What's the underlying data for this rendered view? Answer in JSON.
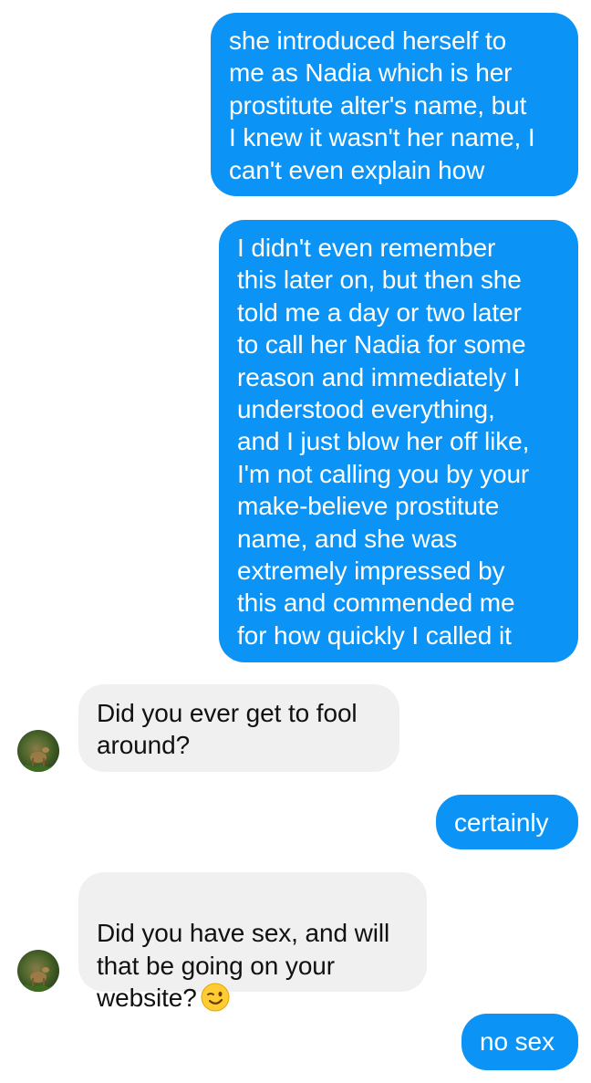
{
  "conversation": {
    "messages": [
      {
        "side": "outgoing",
        "text": "she introduced herself to\nme as Nadia which is her\nprostitute alter's name, but\nI knew it wasn't her name, I\ncan't even explain how"
      },
      {
        "side": "outgoing",
        "text": "I didn't even remember\nthis later on, but then she\ntold me a day or two later\nto call her Nadia for some\nreason and immediately I\nunderstood everything,\nand I just blow her off like,\nI'm not calling you by your\nmake-believe prostitute\nname, and she was\nextremely impressed by\nthis and commended me\nfor how quickly I called it"
      },
      {
        "side": "incoming",
        "text": "Did you ever get to fool\naround?"
      },
      {
        "side": "outgoing",
        "text": "certainly"
      },
      {
        "side": "incoming",
        "text": "Did you have sex, and will\nthat be going on your\nwebsite?",
        "emoji": "winking-face"
      },
      {
        "side": "outgoing",
        "text": "no sex"
      }
    ]
  },
  "colors": {
    "outgoing_bubble": "#0b93f6",
    "incoming_bubble": "#f1f0f0",
    "outgoing_text": "#ffffff",
    "incoming_text": "#111111",
    "background": "#ffffff"
  }
}
